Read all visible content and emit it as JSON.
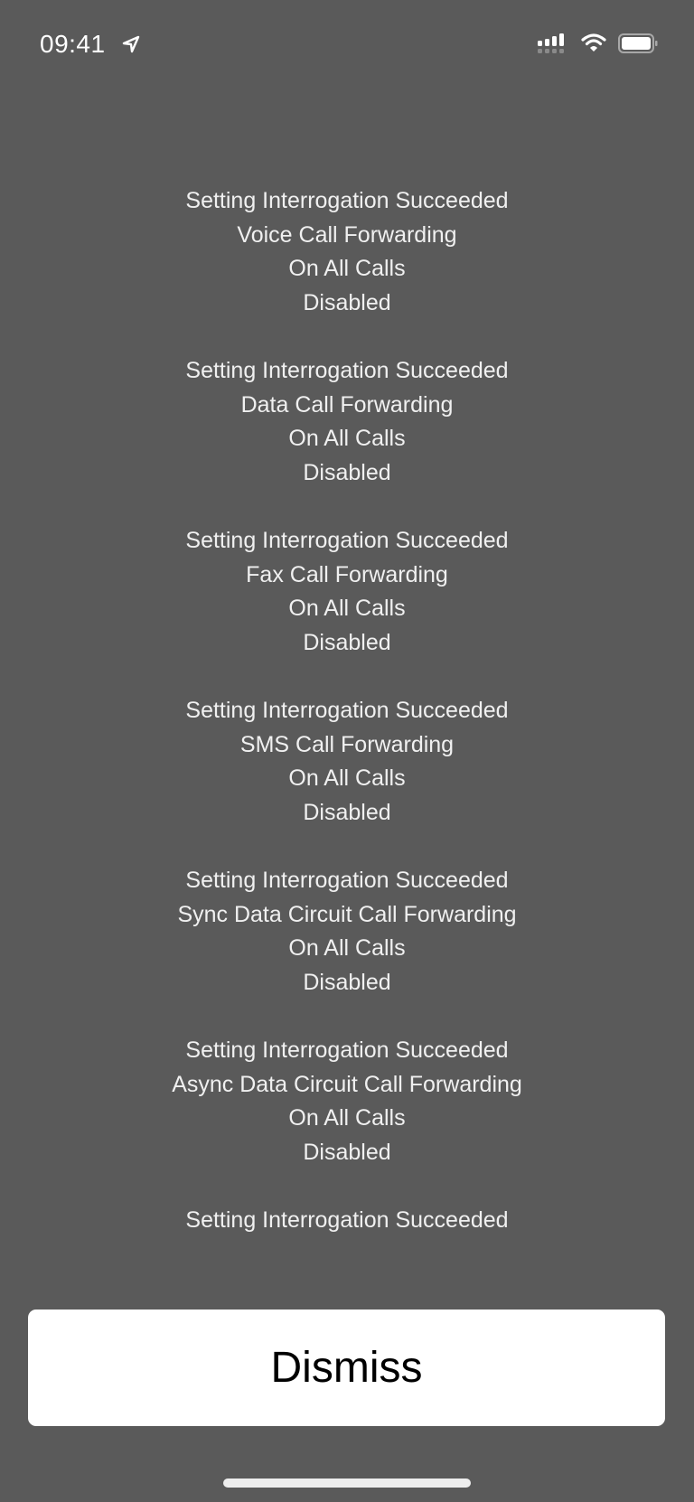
{
  "status_bar": {
    "time": "09:41",
    "icons": [
      "location-arrow-icon",
      "cellular-signal-icon",
      "wifi-icon",
      "battery-icon"
    ]
  },
  "messages": [
    {
      "status": "Setting Interrogation Succeeded",
      "service": "Voice Call Forwarding",
      "condition": "On All Calls",
      "state": "Disabled"
    },
    {
      "status": "Setting Interrogation Succeeded",
      "service": "Data Call Forwarding",
      "condition": "On All Calls",
      "state": "Disabled"
    },
    {
      "status": "Setting Interrogation Succeeded",
      "service": "Fax Call Forwarding",
      "condition": "On All Calls",
      "state": "Disabled"
    },
    {
      "status": "Setting Interrogation Succeeded",
      "service": "SMS Call Forwarding",
      "condition": "On All Calls",
      "state": "Disabled"
    },
    {
      "status": "Setting Interrogation Succeeded",
      "service": "Sync Data Circuit Call Forwarding",
      "condition": "On All Calls",
      "state": "Disabled"
    },
    {
      "status": "Setting Interrogation Succeeded",
      "service": "Async Data Circuit Call Forwarding",
      "condition": "On All Calls",
      "state": "Disabled"
    },
    {
      "status": "Setting Interrogation Succeeded"
    }
  ],
  "dismiss_button": {
    "label": "Dismiss"
  },
  "colors": {
    "background": "#5a5a5a",
    "text": "#f0f0f0",
    "button_bg": "#ffffff",
    "button_text": "#000000"
  }
}
